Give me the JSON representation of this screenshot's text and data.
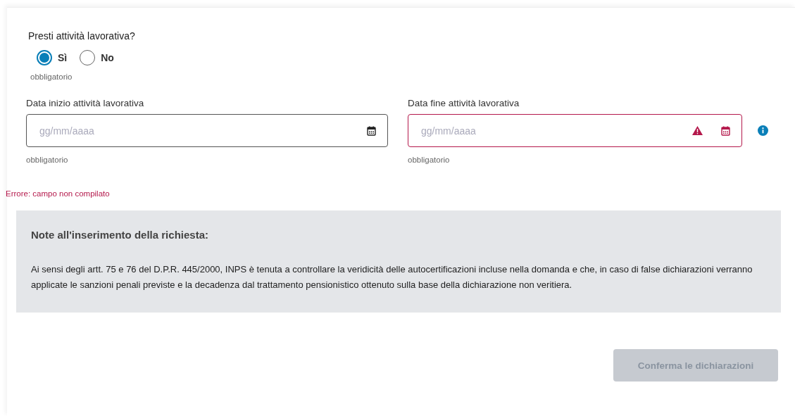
{
  "question": {
    "label": "Presti attività lavorativa?",
    "options": [
      {
        "label": "Sì",
        "selected": true
      },
      {
        "label": "No",
        "selected": false
      }
    ],
    "hint": "obbligatorio"
  },
  "fields": [
    {
      "label": "Data inizio attività lavorativa",
      "placeholder": "gg/mm/aaaa",
      "error": false,
      "info": false,
      "hint": "obbligatorio"
    },
    {
      "label": "Data fine attività lavorativa",
      "placeholder": "gg/mm/aaaa",
      "error": true,
      "info": true,
      "hint": "obbligatorio"
    }
  ],
  "error_message": "Errore: campo non compilato",
  "note": {
    "title": "Note all'inserimento della richiesta:",
    "text": "Ai sensi degli artt. 75 e 76 del D.P.R. 445/2000, INPS è tenuta a controllare la veridicità delle autocertificazioni incluse nella domanda e che, in caso di false dichiarazioni verranno applicate le sanzioni penali previste e la decadenza dal trattamento pensionistico ottenuto sulla base della dichiarazione non veritiera."
  },
  "confirm_button": {
    "label": "Conferma le dichiarazioni",
    "disabled": true
  }
}
